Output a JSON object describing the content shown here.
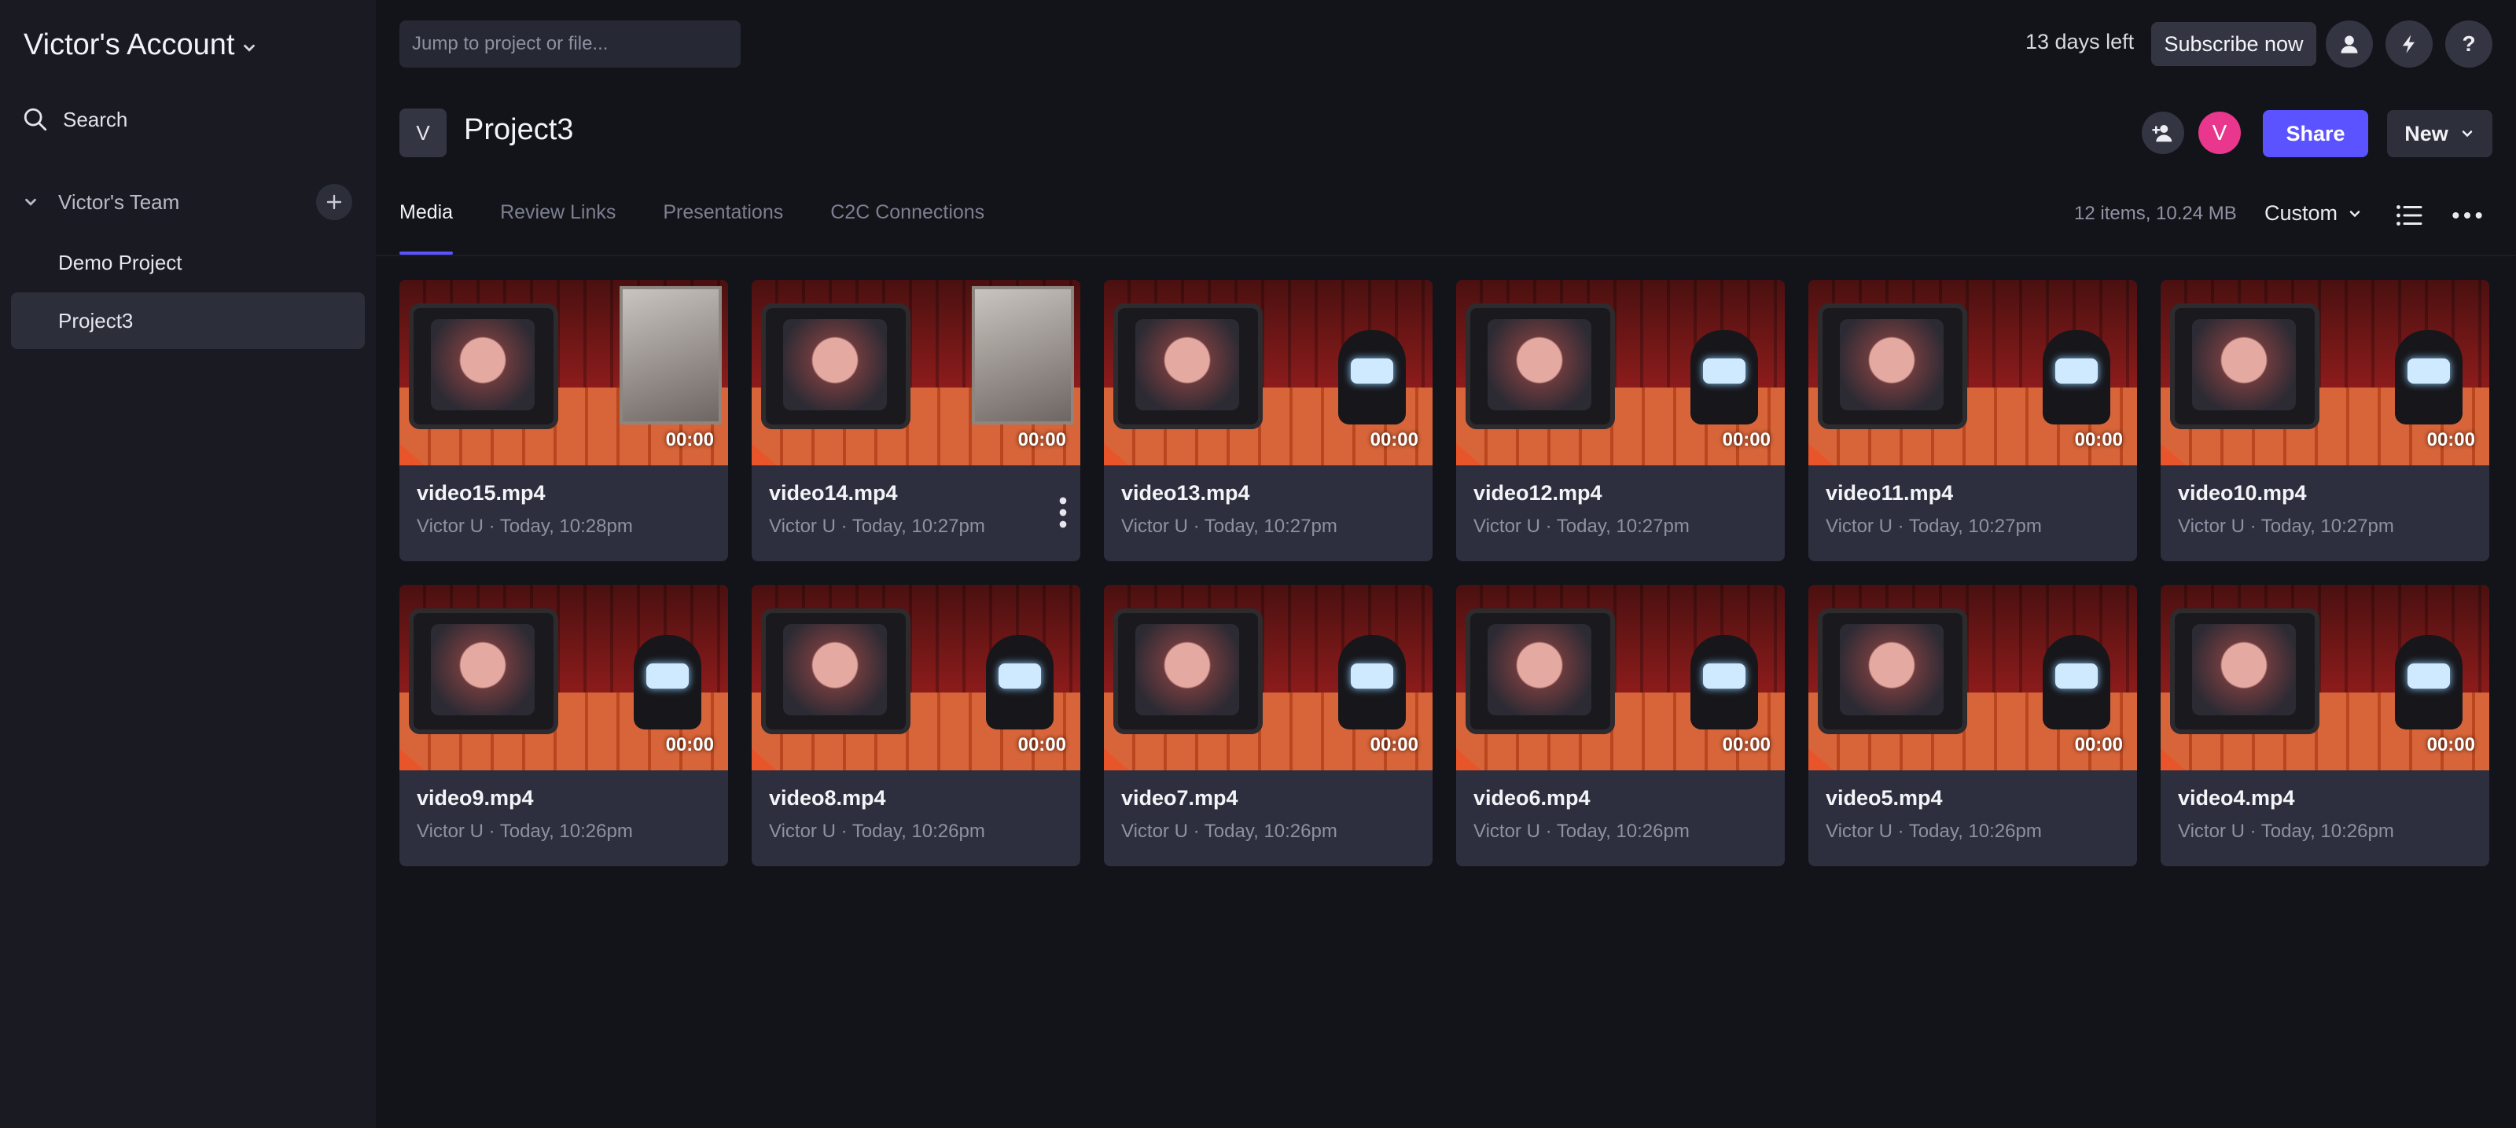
{
  "sidebar": {
    "account_name": "Victor's Account",
    "search_label": "Search",
    "team_name": "Victor's Team",
    "projects": [
      "Demo Project",
      "Project3"
    ],
    "active_project_index": 1
  },
  "topbar": {
    "jump_placeholder": "Jump to project or file...",
    "trial_text": "13 days left",
    "subscribe_label": "Subscribe now",
    "icons": [
      "account-icon",
      "lightning-icon",
      "help-icon"
    ]
  },
  "project": {
    "badge": "V",
    "title": "Project3",
    "avatar_letter": "V",
    "share_label": "Share",
    "new_label": "New"
  },
  "tabs": [
    {
      "label": "Media",
      "active": true
    },
    {
      "label": "Review Links",
      "active": false
    },
    {
      "label": "Presentations",
      "active": false
    },
    {
      "label": "C2C Connections",
      "active": false
    }
  ],
  "toolbar": {
    "meta": "12 items, 10.24 MB",
    "sort_label": "Custom"
  },
  "colors": {
    "accent": "#5b53ff",
    "avatar": "#e8378c",
    "background": "#131419",
    "sidebar": "#191a22",
    "card": "#2d2f3e"
  },
  "media": [
    {
      "name": "video15.mp4",
      "meta": "Victor U · Today, 10:28pm",
      "duration": "00:00",
      "poster": true,
      "menu": false
    },
    {
      "name": "video14.mp4",
      "meta": "Victor U · Today, 10:27pm",
      "duration": "00:00",
      "poster": true,
      "menu": true
    },
    {
      "name": "video13.mp4",
      "meta": "Victor U · Today, 10:27pm",
      "duration": "00:00",
      "poster": false,
      "menu": false
    },
    {
      "name": "video12.mp4",
      "meta": "Victor U · Today, 10:27pm",
      "duration": "00:00",
      "poster": false,
      "menu": false
    },
    {
      "name": "video11.mp4",
      "meta": "Victor U · Today, 10:27pm",
      "duration": "00:00",
      "poster": false,
      "menu": false
    },
    {
      "name": "video10.mp4",
      "meta": "Victor U · Today, 10:27pm",
      "duration": "00:00",
      "poster": false,
      "menu": false
    },
    {
      "name": "video9.mp4",
      "meta": "Victor U · Today, 10:26pm",
      "duration": "00:00",
      "poster": false,
      "menu": false
    },
    {
      "name": "video8.mp4",
      "meta": "Victor U · Today, 10:26pm",
      "duration": "00:00",
      "poster": false,
      "menu": false
    },
    {
      "name": "video7.mp4",
      "meta": "Victor U · Today, 10:26pm",
      "duration": "00:00",
      "poster": false,
      "menu": false
    },
    {
      "name": "video6.mp4",
      "meta": "Victor U · Today, 10:26pm",
      "duration": "00:00",
      "poster": false,
      "menu": false
    },
    {
      "name": "video5.mp4",
      "meta": "Victor U · Today, 10:26pm",
      "duration": "00:00",
      "poster": false,
      "menu": false
    },
    {
      "name": "video4.mp4",
      "meta": "Victor U · Today, 10:26pm",
      "duration": "00:00",
      "poster": false,
      "menu": false
    }
  ]
}
